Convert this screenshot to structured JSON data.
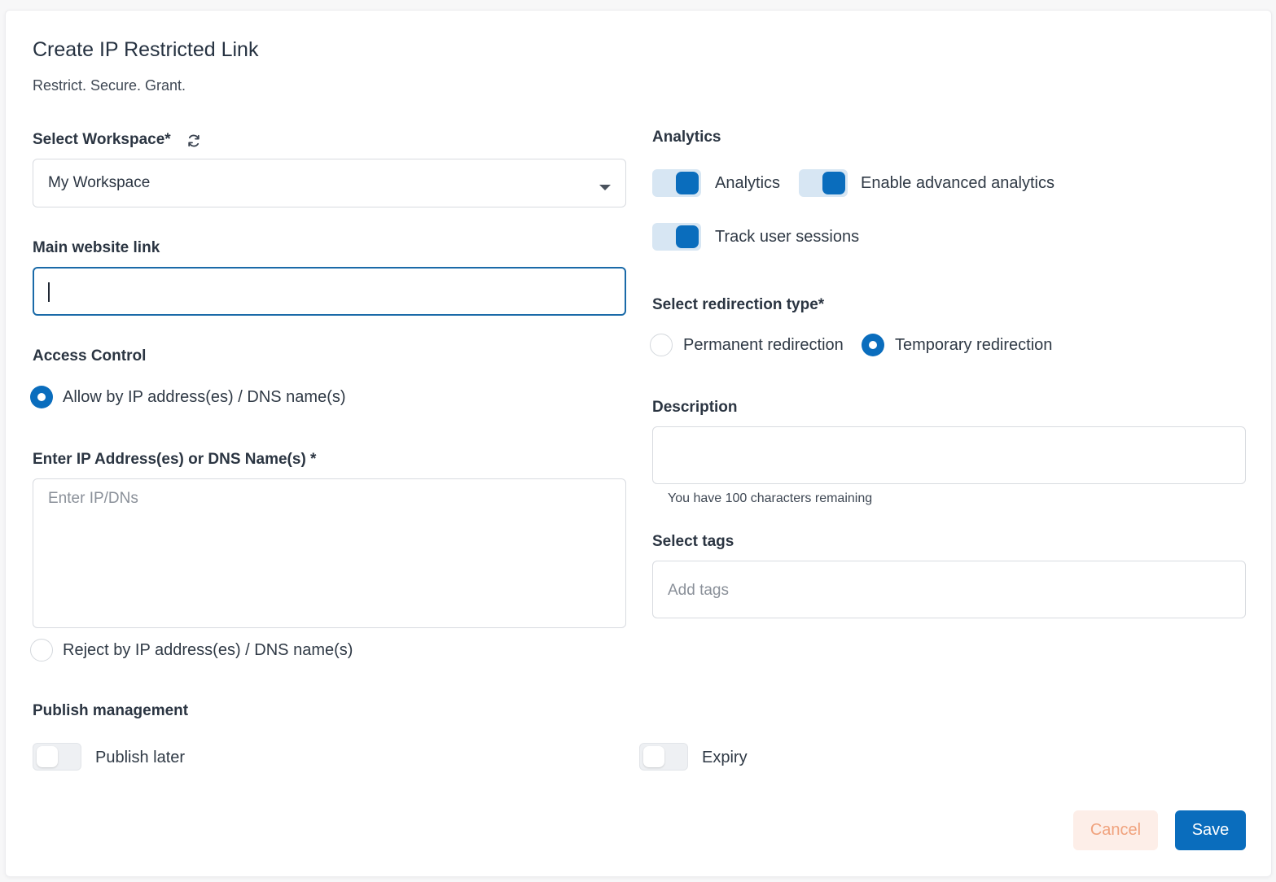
{
  "header": {
    "title": "Create IP Restricted Link",
    "subtitle": "Restrict. Secure. Grant."
  },
  "workspace": {
    "label": "Select Workspace*",
    "selected": "My Workspace"
  },
  "main_link": {
    "label": "Main website link",
    "value": ""
  },
  "access_control": {
    "label": "Access Control",
    "allow_label": "Allow by IP address(es) / DNS name(s)",
    "allow_selected": true,
    "ip_label": "Enter IP Address(es) or DNS Name(s) *",
    "ip_placeholder": "Enter IP/DNs",
    "reject_label": "Reject by IP address(es) / DNS name(s)",
    "reject_selected": false
  },
  "analytics": {
    "section_label": "Analytics",
    "toggles": [
      {
        "label": "Analytics",
        "on": true
      },
      {
        "label": "Enable advanced analytics",
        "on": true
      },
      {
        "label": "Track user sessions",
        "on": true
      }
    ]
  },
  "redirection": {
    "label": "Select redirection type*",
    "options": [
      {
        "label": "Permanent redirection",
        "selected": false
      },
      {
        "label": "Temporary redirection",
        "selected": true
      }
    ]
  },
  "description": {
    "label": "Description",
    "value": "",
    "helper": "You have 100 characters remaining"
  },
  "tags": {
    "label": "Select tags",
    "placeholder": "Add tags"
  },
  "publish": {
    "label": "Publish management",
    "publish_later": {
      "label": "Publish later",
      "on": false
    },
    "expiry": {
      "label": "Expiry",
      "on": false
    }
  },
  "actions": {
    "cancel": "Cancel",
    "save": "Save"
  },
  "colors": {
    "accent": "#0a6dbd",
    "toggle_track_on": "#d7e6f3",
    "cancel_bg": "#fdeee8",
    "cancel_text": "#f0a27d"
  },
  "icons": {
    "refresh": "refresh-icon",
    "dropdown": "caret-down-icon"
  }
}
